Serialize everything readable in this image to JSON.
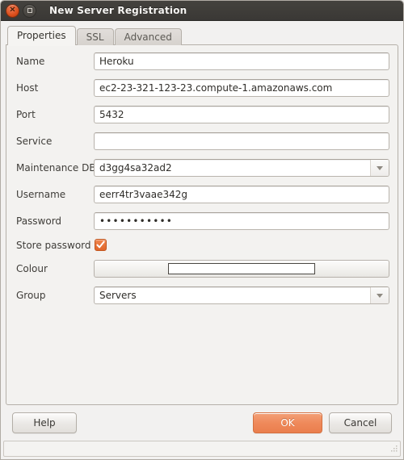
{
  "window": {
    "title": "New Server Registration",
    "close_icon": "close-icon",
    "close_glyph": "×",
    "restore_icon": "restore-icon"
  },
  "tabs": [
    {
      "label": "Properties",
      "active": true
    },
    {
      "label": "SSL",
      "active": false
    },
    {
      "label": "Advanced",
      "active": false
    }
  ],
  "form": {
    "name": {
      "label": "Name",
      "value": "Heroku"
    },
    "host": {
      "label": "Host",
      "value": "ec2-23-321-123-23.compute-1.amazonaws.com"
    },
    "port": {
      "label": "Port",
      "value": "5432"
    },
    "service": {
      "label": "Service",
      "value": ""
    },
    "maintenance": {
      "label": "Maintenance DB",
      "value": "d3gg4sa32ad2"
    },
    "username": {
      "label": "Username",
      "value": "eerr4tr3vaae342g"
    },
    "password": {
      "label": "Password",
      "value": "•••••••••••"
    },
    "store_password": {
      "label": "Store password",
      "checked": true,
      "icon": "checkmark-icon"
    },
    "colour": {
      "label": "Colour",
      "swatch": "#ffffff"
    },
    "group": {
      "label": "Group",
      "value": "Servers"
    }
  },
  "buttons": {
    "help": "Help",
    "ok": "OK",
    "cancel": "Cancel"
  },
  "statusbar": {
    "text": ""
  },
  "colors": {
    "accent_orange": "#ea7e4d",
    "checkbox_orange": "#e0662a",
    "titlebar": "#3c3a36",
    "window_bg": "#f2f1f0"
  }
}
